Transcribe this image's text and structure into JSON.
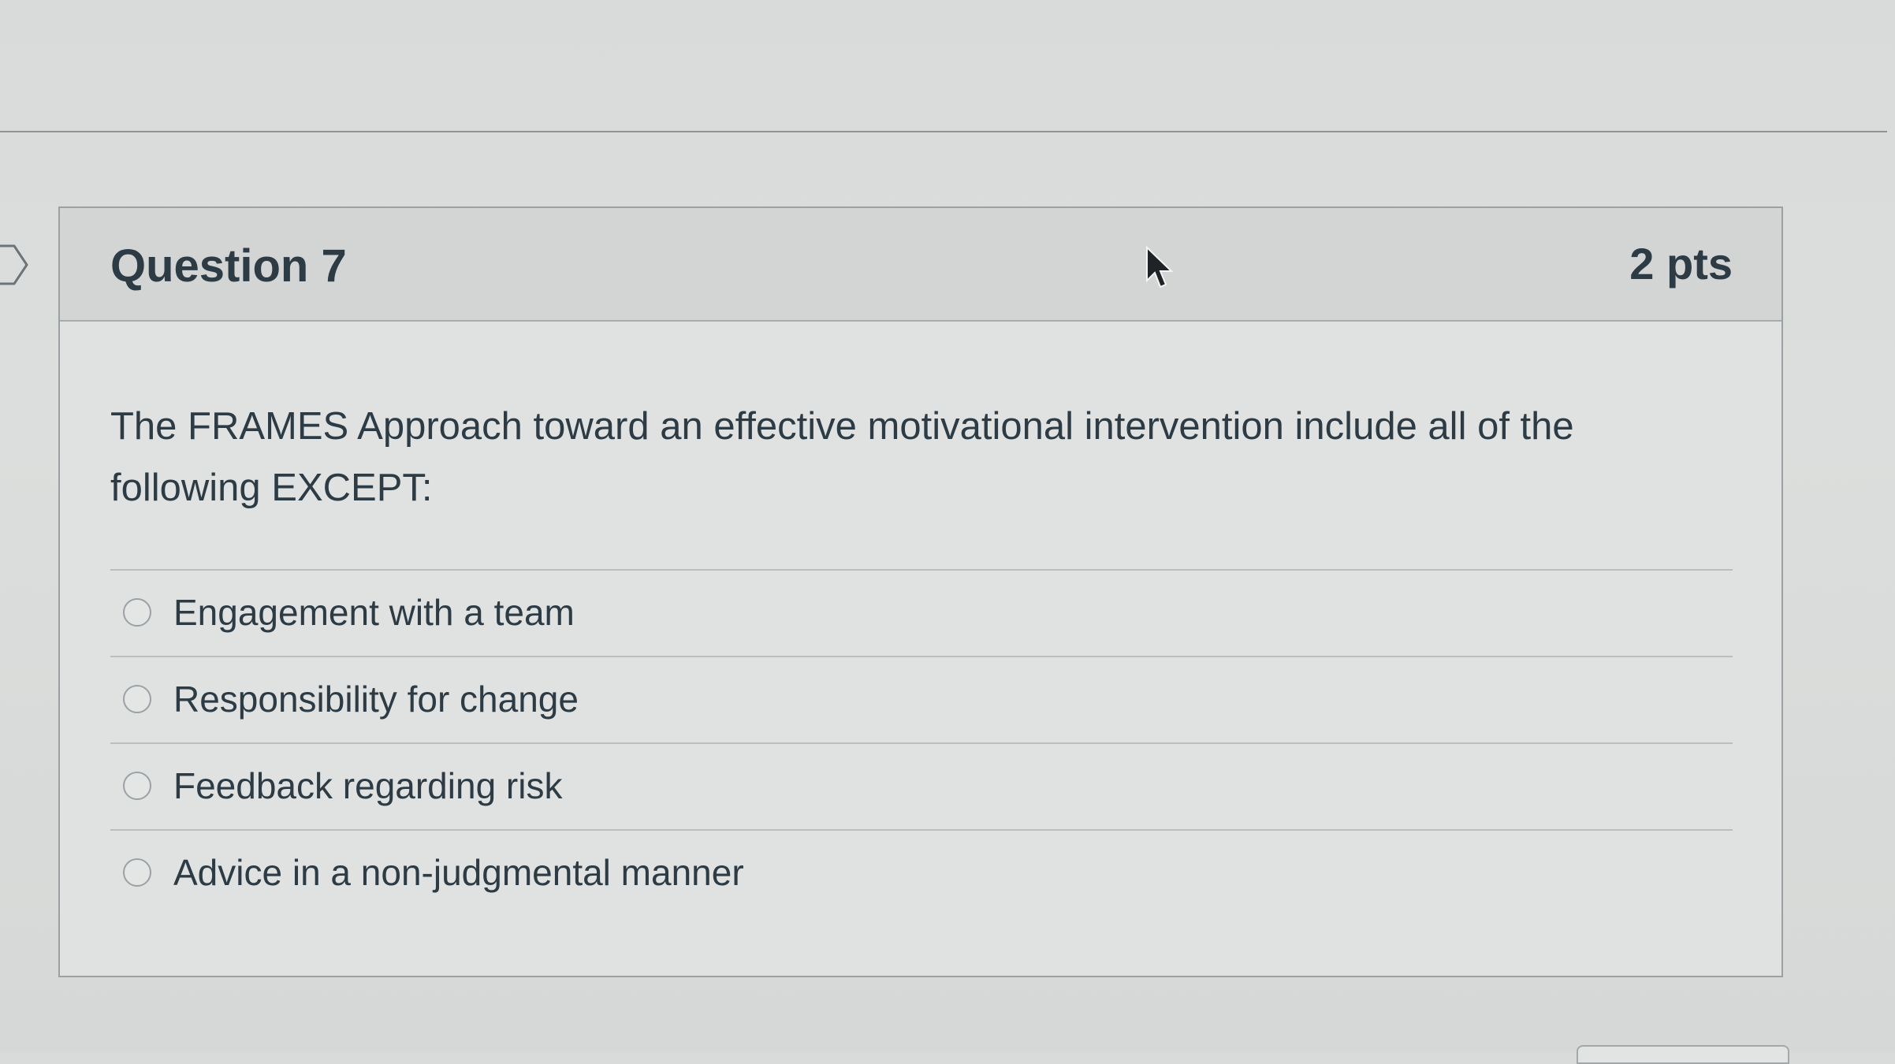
{
  "question": {
    "title": "Question 7",
    "points": "2 pts",
    "text": "The FRAMES Approach toward an effective motivational intervention include all of the following EXCEPT:"
  },
  "answers": [
    {
      "label": "Engagement with a team",
      "selected": false
    },
    {
      "label": "Responsibility for change",
      "selected": false
    },
    {
      "label": "Feedback regarding risk",
      "selected": false
    },
    {
      "label": "Advice in a non-judgmental manner",
      "selected": false
    }
  ],
  "icons": {
    "flag": "flag-icon",
    "cursor": "mouse-pointer-icon",
    "radio": "radio-button-icon"
  },
  "colors": {
    "text": "#2d3b45",
    "header_bg": "#d3d5d5",
    "card_border": "#9aa0a3"
  }
}
